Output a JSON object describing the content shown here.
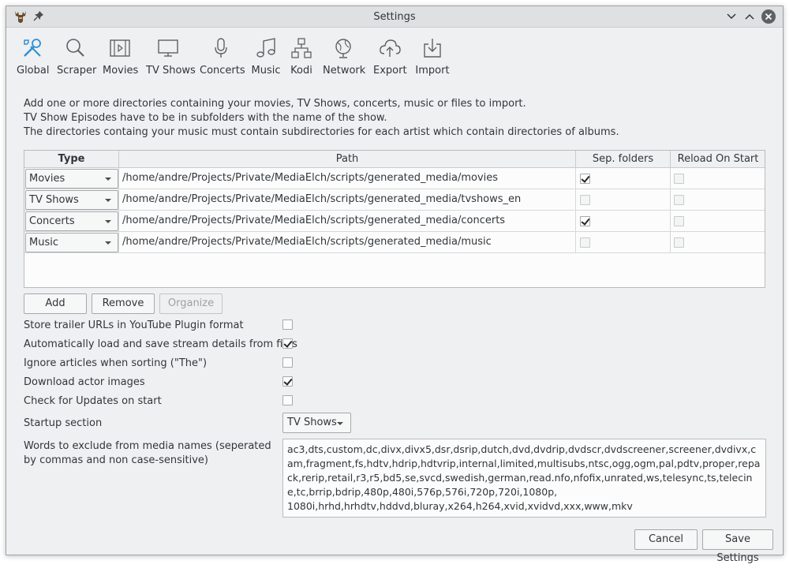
{
  "window": {
    "title": "Settings"
  },
  "toolbar": {
    "items": [
      {
        "label": "Global",
        "icon": "tools-icon"
      },
      {
        "label": "Scraper",
        "icon": "search-icon"
      },
      {
        "label": "Movies",
        "icon": "film-icon"
      },
      {
        "label": "TV Shows",
        "icon": "monitor-icon"
      },
      {
        "label": "Concerts",
        "icon": "microphone-icon"
      },
      {
        "label": "Music",
        "icon": "music-note-icon"
      },
      {
        "label": "Kodi",
        "icon": "network-tree-icon"
      },
      {
        "label": "Network",
        "icon": "globe-icon"
      },
      {
        "label": "Export",
        "icon": "cloud-upload-icon"
      },
      {
        "label": "Import",
        "icon": "import-icon"
      }
    ]
  },
  "intro": {
    "line1": "Add one or more directories containing your movies, TV Shows, concerts, music or files to import.",
    "line2": "TV Show Episodes have to be in subfolders with the name of the show.",
    "line3": "The directories containg your music must contain subdirectories for each artist which contain directories of albums."
  },
  "directories": {
    "headers": {
      "type": "Type",
      "path": "Path",
      "sep": "Sep. folders",
      "reload": "Reload On Start"
    },
    "rows": [
      {
        "type": "Movies",
        "path": "/home/andre/Projects/Private/MediaElch/scripts/generated_media/movies",
        "sep": true,
        "sep_enabled": true,
        "reload": false
      },
      {
        "type": "TV Shows",
        "path": "/home/andre/Projects/Private/MediaElch/scripts/generated_media/tvshows_en",
        "sep": false,
        "sep_enabled": false,
        "reload": false
      },
      {
        "type": "Concerts",
        "path": "/home/andre/Projects/Private/MediaElch/scripts/generated_media/concerts",
        "sep": true,
        "sep_enabled": true,
        "reload": false
      },
      {
        "type": "Music",
        "path": "/home/andre/Projects/Private/MediaElch/scripts/generated_media/music",
        "sep": false,
        "sep_enabled": false,
        "reload": false
      }
    ]
  },
  "buttons": {
    "add": "Add",
    "remove": "Remove",
    "organize": "Organize",
    "cancel": "Cancel",
    "save": "Save Settings"
  },
  "options": {
    "trailer": {
      "label": "Store trailer URLs in YouTube Plugin format",
      "checked": false
    },
    "stream": {
      "label": "Automatically load and save stream details from files",
      "checked": true
    },
    "articles": {
      "label": "Ignore articles when sorting (\"The\")",
      "checked": false
    },
    "actors": {
      "label": "Download actor images",
      "checked": true
    },
    "updates": {
      "label": "Check for Updates on start",
      "checked": false
    }
  },
  "startup": {
    "label": "Startup section",
    "value": "TV Shows"
  },
  "exclude": {
    "label": "Words to exclude from media names (seperated by commas and non case-sensitive)",
    "value": "ac3,dts,custom,dc,divx,divx5,dsr,dsrip,dutch,dvd,dvdrip,dvdscr,dvdscreener,screener,dvdivx,cam,fragment,fs,hdtv,hdrip,hdtvrip,internal,limited,multisubs,ntsc,ogg,ogm,pal,pdtv,proper,repack,rerip,retail,r3,r5,bd5,se,svcd,swedish,german,read.nfo,nfofix,unrated,ws,telesync,ts,telecine,tc,brrip,bdrip,480p,480i,576p,576i,720p,720i,1080p,\n1080i,hrhd,hrhdtv,hddvd,bluray,x264,h264,xvid,xvidvd,xxx,www,mkv"
  }
}
